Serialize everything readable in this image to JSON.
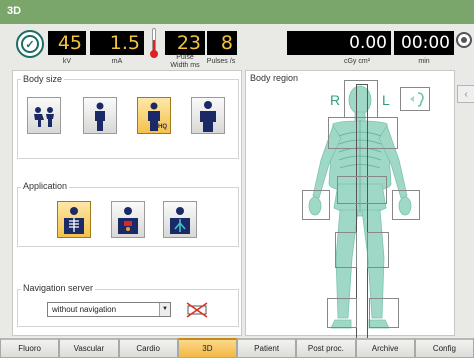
{
  "window": {
    "title": "3D"
  },
  "status": {
    "kv_value": "45",
    "kv_unit": "kV",
    "ma_value": "1.5",
    "ma_unit": "mA",
    "pulse_width_value": "23",
    "pulse_width_unit": "Pulse\nWidth ms",
    "pulses_value": "8",
    "pulses_unit": "Pulses /s",
    "dose_value": "0.00",
    "dose_unit": "cGy cm²",
    "time_value": "00:00",
    "time_unit": "min",
    "readout_color": "#f3c33b"
  },
  "body_size": {
    "title": "Body size",
    "options": [
      {
        "name": "children",
        "icon": "two-children-icon",
        "selected": false
      },
      {
        "name": "small-adult",
        "icon": "small-person-icon",
        "selected": false
      },
      {
        "name": "adult-hq",
        "icon": "person-hq-icon",
        "badge": "HQ",
        "selected": true
      },
      {
        "name": "large-adult",
        "icon": "large-person-icon",
        "selected": false
      }
    ]
  },
  "application": {
    "title": "Application",
    "options": [
      {
        "name": "skeleton",
        "icon": "skeleton-icon",
        "selected": true
      },
      {
        "name": "organs",
        "icon": "organs-icon",
        "selected": false
      },
      {
        "name": "vessels",
        "icon": "vessels-icon",
        "selected": false
      }
    ]
  },
  "navigation": {
    "title": "Navigation server",
    "selected": "without navigation",
    "status_icon": "no-navigation-icon"
  },
  "body_region": {
    "title": "Body region",
    "right_label": "R",
    "left_label": "L",
    "ear_icon": "ear-icon",
    "accent_color": "#2f9f84"
  },
  "tabs": [
    {
      "label": "Fluoro",
      "active": false
    },
    {
      "label": "Vascular",
      "active": false
    },
    {
      "label": "Cardio",
      "active": false
    },
    {
      "label": "3D",
      "active": true
    },
    {
      "label": "Patient",
      "active": false
    },
    {
      "label": "Post proc.",
      "active": false
    },
    {
      "label": "Archive",
      "active": false
    },
    {
      "label": "Config",
      "active": false
    }
  ]
}
